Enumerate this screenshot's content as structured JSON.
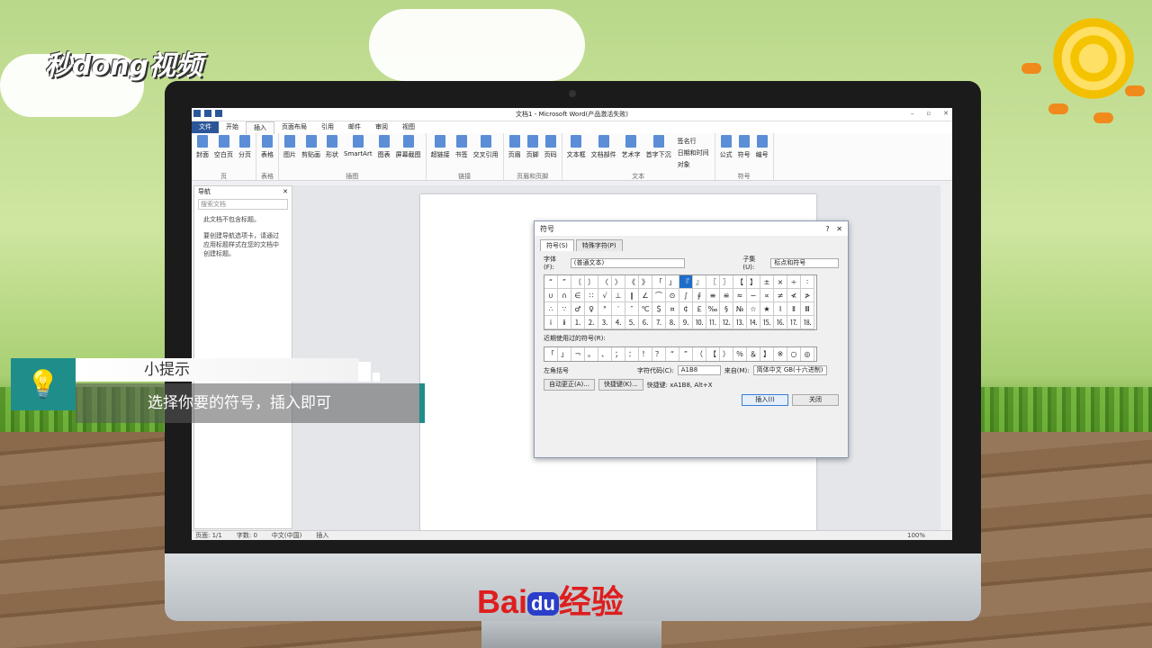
{
  "brand": {
    "logo_text": "秒dong视频",
    "baidu_left": "Bai",
    "baidu_du": "du",
    "baidu_right": "经验"
  },
  "window": {
    "title": "文档1 - Microsoft Word(产品激活失败)"
  },
  "ribbon": {
    "tabs": [
      "文件",
      "开始",
      "插入",
      "页面布局",
      "引用",
      "邮件",
      "审阅",
      "视图"
    ],
    "active_tab": "插入",
    "groups": [
      {
        "label": "页",
        "buttons": [
          "封面",
          "空白页",
          "分页"
        ]
      },
      {
        "label": "表格",
        "buttons": [
          "表格"
        ]
      },
      {
        "label": "插图",
        "buttons": [
          "图片",
          "剪贴画",
          "形状",
          "SmartArt",
          "图表",
          "屏幕截图"
        ]
      },
      {
        "label": "链接",
        "buttons": [
          "超链接",
          "书签",
          "交叉引用"
        ]
      },
      {
        "label": "页眉和页脚",
        "buttons": [
          "页眉",
          "页脚",
          "页码"
        ]
      },
      {
        "label": "文本",
        "buttons": [
          "文本框",
          "文档部件",
          "艺术字",
          "首字下沉"
        ]
      },
      {
        "label": "符号",
        "buttons": [
          "公式",
          "符号",
          "编号"
        ]
      }
    ],
    "text_small": [
      "签名行",
      "日期和时间",
      "对象"
    ]
  },
  "nav_pane": {
    "title": "导航",
    "search_placeholder": "搜索文档",
    "message1": "此文档不包含标题。",
    "message2": "要创建导航选项卡，请通过应用标题样式在您的文档中创建标题。"
  },
  "statusbar": {
    "page": "页面: 1/1",
    "words": "字数: 0",
    "lang": "中文(中国)",
    "mode": "插入",
    "zoom": "100%"
  },
  "dialog": {
    "title": "符号",
    "help": "?",
    "tabs": [
      "符号(S)",
      "特殊字符(P)"
    ],
    "font_label": "字体(F):",
    "font_value": "(普通文本)",
    "subset_label": "子集(U):",
    "subset_value": "标点和符号",
    "symbols": [
      "“",
      "”",
      "〔",
      "〕",
      "〈",
      "〉",
      "《",
      "》",
      "「",
      "」",
      "『",
      "』",
      "〖",
      "〗",
      "【",
      "】",
      "±",
      "×",
      "÷",
      "∶",
      "∪",
      "∩",
      "∈",
      "∷",
      "√",
      "⊥",
      "∥",
      "∠",
      "⌒",
      "⊙",
      "∫",
      "∮",
      "≡",
      "≌",
      "≈",
      "∽",
      "∝",
      "≠",
      "≮",
      "≯",
      "∴",
      "∵",
      "♂",
      "♀",
      "°",
      "′",
      "″",
      "℃",
      "＄",
      "¤",
      "￠",
      "￡",
      "‰",
      "§",
      "№",
      "☆",
      "★",
      "Ⅰ",
      "Ⅱ",
      "Ⅲ",
      "ⅰ",
      "ⅱ",
      "⒈",
      "⒉",
      "⒊",
      "⒋",
      "⒌",
      "⒍",
      "⒎",
      "⒏",
      "⒐",
      "⒑",
      "⒒",
      "⒓",
      "⒔",
      "⒕",
      "⒖",
      "⒗",
      "⒘",
      "⒙"
    ],
    "recent_label": "近期使用过的符号(R):",
    "recent": [
      "「",
      "」",
      "¬",
      "。",
      "、",
      "；",
      "：",
      "！",
      "？",
      "“",
      "”",
      "（",
      "【",
      "）",
      "％",
      "＆",
      "】",
      "※",
      "○",
      "◎"
    ],
    "char_name": "左角括号",
    "code_label": "字符代码(C):",
    "code_value": "A1B8",
    "from_label": "来自(M):",
    "from_value": "简体中文 GB(十六进制)",
    "autocorrect": "自动更正(A)...",
    "shortcut_btn": "快捷键(K)...",
    "shortcut_text": "快捷键: xA1B8, Alt+X",
    "insert": "插入(I)",
    "close": "关闭"
  },
  "tip": {
    "icon": "lightbulb-icon",
    "title": "小提示",
    "body": "选择你要的符号，插入即可"
  },
  "colors": {
    "accent": "#1f8d8a",
    "word_blue": "#2b579a",
    "baidu_red": "#de1e1e"
  }
}
